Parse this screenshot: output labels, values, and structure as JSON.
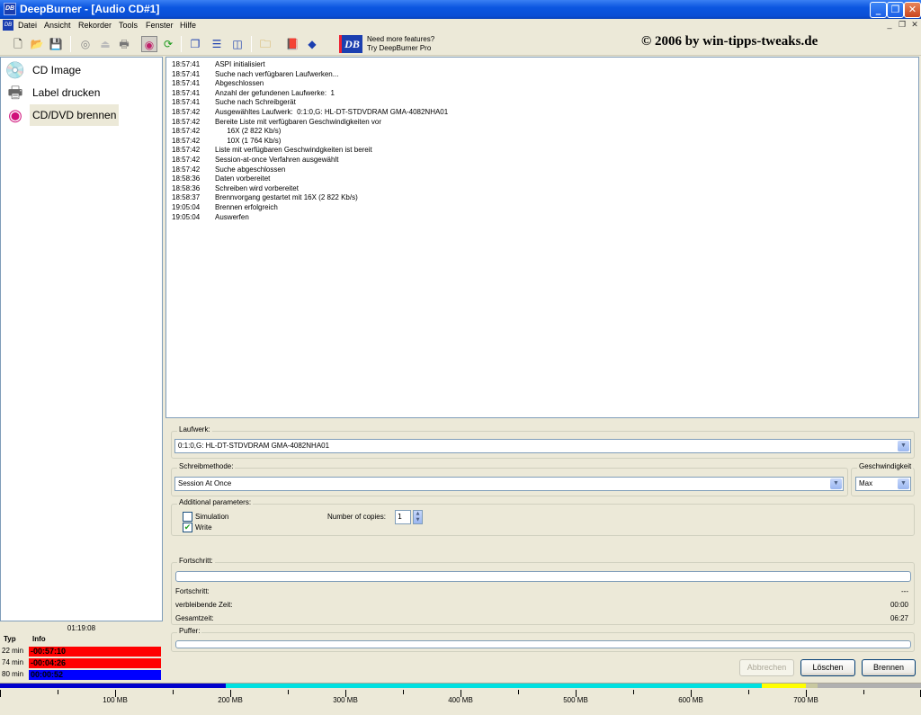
{
  "window": {
    "title": "DeepBurner - [Audio CD#1]",
    "app_icon_text": "DB",
    "minimize_glyph": "_",
    "maximize_glyph": "❐",
    "close_glyph": "✕"
  },
  "menu": {
    "items": [
      "Datei",
      "Ansicht",
      "Rekorder",
      "Tools",
      "Fenster",
      "Hilfe"
    ],
    "mdi_minimize": "_",
    "mdi_restore": "❐",
    "mdi_close": "✕"
  },
  "toolbar": {
    "promo_line1": "Need more features?",
    "promo_line2": "Try DeepBurner Pro",
    "logo_text": "DB",
    "copyright": "© 2006 by win-tipps-tweaks.de"
  },
  "nav": {
    "items": [
      {
        "label": "CD Image",
        "icon": "cd-icon"
      },
      {
        "label": "Label drucken",
        "icon": "printer-icon"
      },
      {
        "label": "CD/DVD brennen",
        "icon": "burn-disc-icon",
        "active": true
      }
    ]
  },
  "status": {
    "total_time": "01:19:08",
    "col_type": "Typ",
    "col_info": "Info",
    "rows": [
      {
        "type": "22 min",
        "info": "-00:57:10",
        "color": "#ff0000"
      },
      {
        "type": "74 min",
        "info": "-00:04:26",
        "color": "#ff0000"
      },
      {
        "type": "80 min",
        "info": "00:00:52",
        "color": "#0000ff"
      }
    ]
  },
  "log": [
    {
      "time": "18:57:41",
      "msg": "ASPI initialisiert"
    },
    {
      "time": "18:57:41",
      "msg": "Suche nach verfügbaren Laufwerken..."
    },
    {
      "time": "18:57:41",
      "msg": "Abgeschlossen"
    },
    {
      "time": "18:57:41",
      "msg": "Anzahl der gefundenen Laufwerke:  1"
    },
    {
      "time": "18:57:41",
      "msg": "Suche nach Schreibgerät"
    },
    {
      "time": "18:57:42",
      "msg": "Ausgewähltes Laufwerk:  0:1:0,G: HL-DT-STDVDRAM GMA-4082NHA01"
    },
    {
      "time": "18:57:42",
      "msg": "Bereite Liste mit verfügbaren Geschwindigkeiten vor"
    },
    {
      "time": "18:57:42",
      "msg": "      16X (2 822 Kb/s)"
    },
    {
      "time": "18:57:42",
      "msg": "      10X (1 764 Kb/s)"
    },
    {
      "time": "18:57:42",
      "msg": "Liste mit verfügbaren Geschwindgkeiten ist bereit"
    },
    {
      "time": "18:57:42",
      "msg": "Session-at-once Verfahren ausgewählt"
    },
    {
      "time": "18:57:42",
      "msg": "Suche abgeschlossen"
    },
    {
      "time": "18:58:36",
      "msg": "Daten vorbereitet"
    },
    {
      "time": "18:58:36",
      "msg": "Schreiben wird vorbereitet"
    },
    {
      "time": "18:58:37",
      "msg": "Brennvorgang gestartet mit 16X (2 822 Kb/s)"
    },
    {
      "time": "19:05:04",
      "msg": "Brennen erfolgreich"
    },
    {
      "time": "19:05:04",
      "msg": "Auswerfen"
    }
  ],
  "drive": {
    "group_label": "Laufwerk:",
    "selected": "0:1:0,G: HL-DT-STDVDRAM GMA-4082NHA01"
  },
  "write_method": {
    "group_label": "Schreibmethode:",
    "selected": "Session At Once"
  },
  "speed": {
    "group_label": "Geschwindigkeit",
    "selected": "Max"
  },
  "params": {
    "group_label": "Additional parameters:",
    "simulation_label": "Simulation",
    "simulation_checked": false,
    "write_label": "Write",
    "write_checked": true,
    "copies_label": "Number of copies:",
    "copies_value": "1"
  },
  "progress": {
    "group_label": "Fortschritt:",
    "fortschritt_label": "Fortschritt:",
    "fortschritt_value": "---",
    "remaining_label": "verbleibende Zeit:",
    "remaining_value": "00:00",
    "total_label": "Gesamtzeit:",
    "total_value": "06:27",
    "progress_fraction": 0
  },
  "buffer": {
    "group_label": "Puffer:",
    "buffer_fraction": 0
  },
  "buttons": {
    "abort": "Abbrechen",
    "delete": "Löschen",
    "burn": "Brennen"
  },
  "capacity": {
    "labels": [
      "100 MB",
      "200 MB",
      "300 MB",
      "400 MB",
      "500 MB",
      "600 MB",
      "700 MB"
    ],
    "max_mb": 800,
    "segments": [
      {
        "from_mb": 0,
        "to_mb": 196,
        "color": "#0000cc"
      },
      {
        "from_mb": 196,
        "to_mb": 662,
        "color": "#00e0e0"
      },
      {
        "from_mb": 662,
        "to_mb": 700,
        "color": "#ffff00"
      },
      {
        "from_mb": 700,
        "to_mb": 710,
        "color": "#c8c8a0"
      },
      {
        "from_mb": 710,
        "to_mb": 800,
        "color": "#b0b0b0"
      }
    ]
  }
}
